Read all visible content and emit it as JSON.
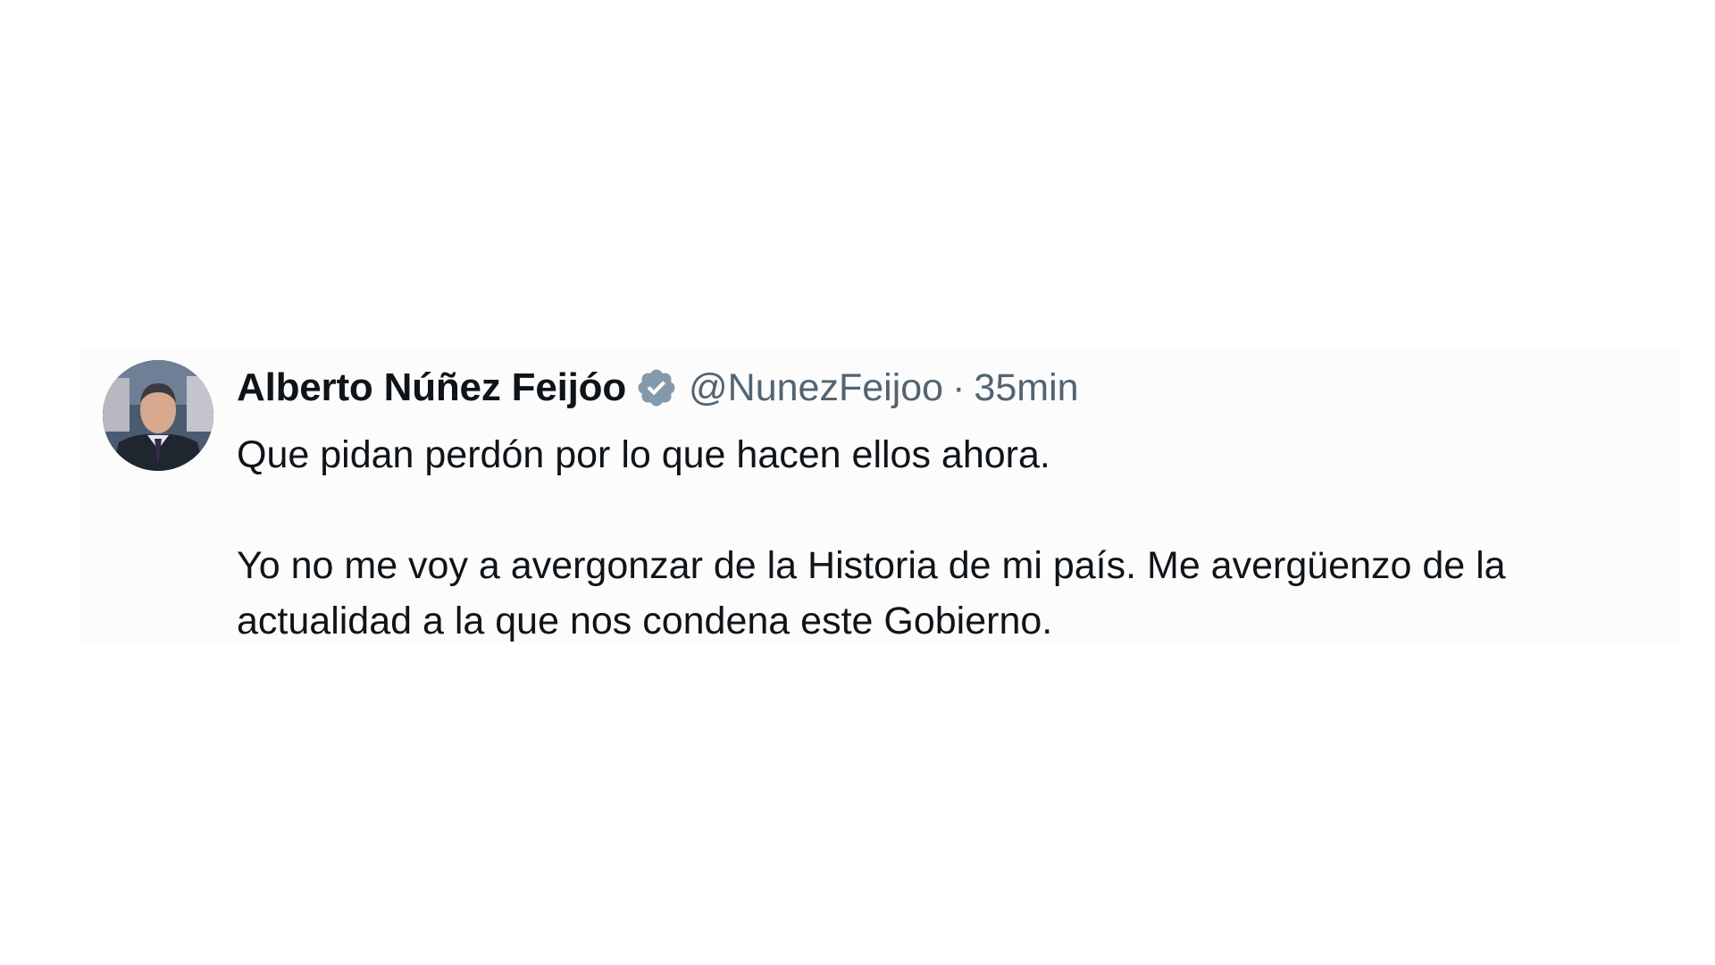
{
  "tweet": {
    "author_name": "Alberto Núñez Feijóo",
    "handle": "@NunezFeijoo",
    "separator": "·",
    "time": "35min",
    "verified_icon": "verified-badge-icon",
    "avatar_icon": "profile-photo",
    "paragraphs": [
      "Que pidan perdón por lo que hacen ellos ahora.",
      "Yo no me voy a avergonzar de la Historia de mi país. Me avergüenzo de la actualidad a la que nos condena este Gobierno."
    ]
  },
  "colors": {
    "text_primary": "#0f1419",
    "text_secondary": "#536471",
    "verified_badge": "#829aab",
    "background": "#ffffff"
  }
}
